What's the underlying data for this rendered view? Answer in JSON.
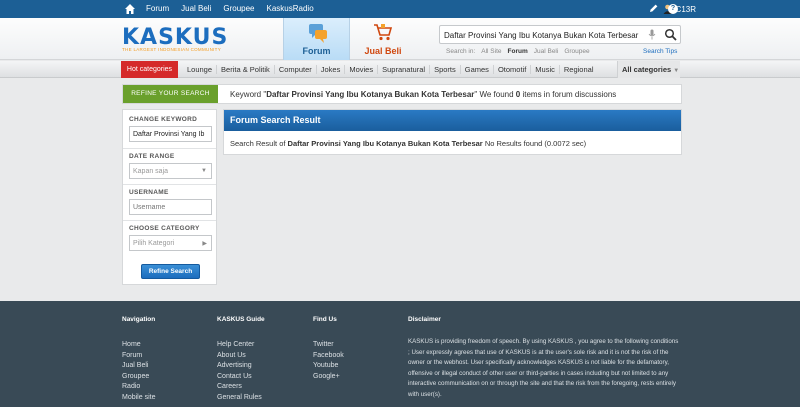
{
  "topbar": {
    "nav": [
      "Forum",
      "Jual Beli",
      "Groupee",
      "KaskusRadio"
    ],
    "username": "C13R"
  },
  "header": {
    "logo_text": "KASKUS",
    "logo_tagline": "THE LARGEST INDONESIAN COMMUNITY",
    "tab_forum": "Forum",
    "tab_jualbeli": "Jual Beli",
    "search_value": "Daftar Provinsi Yang Ibu Kotanya Bukan Kota Terbesar",
    "search_in_label": "Search in:",
    "search_in_options": [
      "All Site",
      "Forum",
      "Jual Beli",
      "Groupee"
    ],
    "search_tips": "Search Tips"
  },
  "categories": {
    "hot": "Hot categories",
    "items": [
      "Lounge",
      "Berita & Politik",
      "Computer",
      "Jokes",
      "Movies",
      "Supranatural",
      "Sports",
      "Games",
      "Otomotif",
      "Music",
      "Regional"
    ],
    "all": "All categories"
  },
  "refine": {
    "label": "REFINE YOUR SEARCH",
    "kw_prefix": "Keyword \"",
    "kw_value": "Daftar Provinsi Yang Ibu Kotanya Bukan Kota Terbesar",
    "kw_mid": "\" We found ",
    "kw_count": "0",
    "kw_suffix": " items in forum discussions"
  },
  "leftpanel": {
    "change_keyword": "CHANGE KEYWORD",
    "keyword_value": "Daftar Provinsi Yang Ib",
    "date_range": "DATE RANGE",
    "date_value": "Kapan saja",
    "username": "USERNAME",
    "username_placeholder": "Username",
    "choose_category": "CHOOSE CATEGORY",
    "category_value": "Pilih Kategori",
    "refine_button": "Refine Search"
  },
  "result": {
    "title": "Forum Search Result",
    "prefix": "Search Result of ",
    "query": "Daftar Provinsi Yang Ibu Kotanya Bukan Kota Terbesar",
    "suffix": " No Results found (0.0072 sec)"
  },
  "footer": {
    "navigation": {
      "title": "Navigation",
      "links": [
        "Home",
        "Forum",
        "Jual Beli",
        "Groupee",
        "Radio",
        "Mobile site"
      ]
    },
    "guide": {
      "title": "KASKUS Guide",
      "links": [
        "Help Center",
        "About Us",
        "Advertising",
        "Contact Us",
        "Careers",
        "General Rules"
      ]
    },
    "findus": {
      "title": "Find Us",
      "links": [
        "Twitter",
        "Facebook",
        "Youtube",
        "Google+"
      ]
    },
    "disclaimer": {
      "title": "Disclaimer",
      "text": "KASKUS is providing freedom of speech. By using KASKUS , you agree to the following conditions ; User expressly agrees that use of KASKUS is at the user's sole risk and it is not the risk of the owner or the webhost. User specifically acknowledges KASKUS is not liable for the defamatory, offensive or illegal conduct of other user or third-parties in cases including but not limited to any interactive communication on or through the site and that the risk from the foregoing, rests entirely with user(s)."
    }
  },
  "colors": {
    "topbar": "#1c5f95",
    "accent": "#1c6dbe",
    "hot": "#d52a2a",
    "refine": "#6aa02c",
    "footer": "#394a56"
  }
}
